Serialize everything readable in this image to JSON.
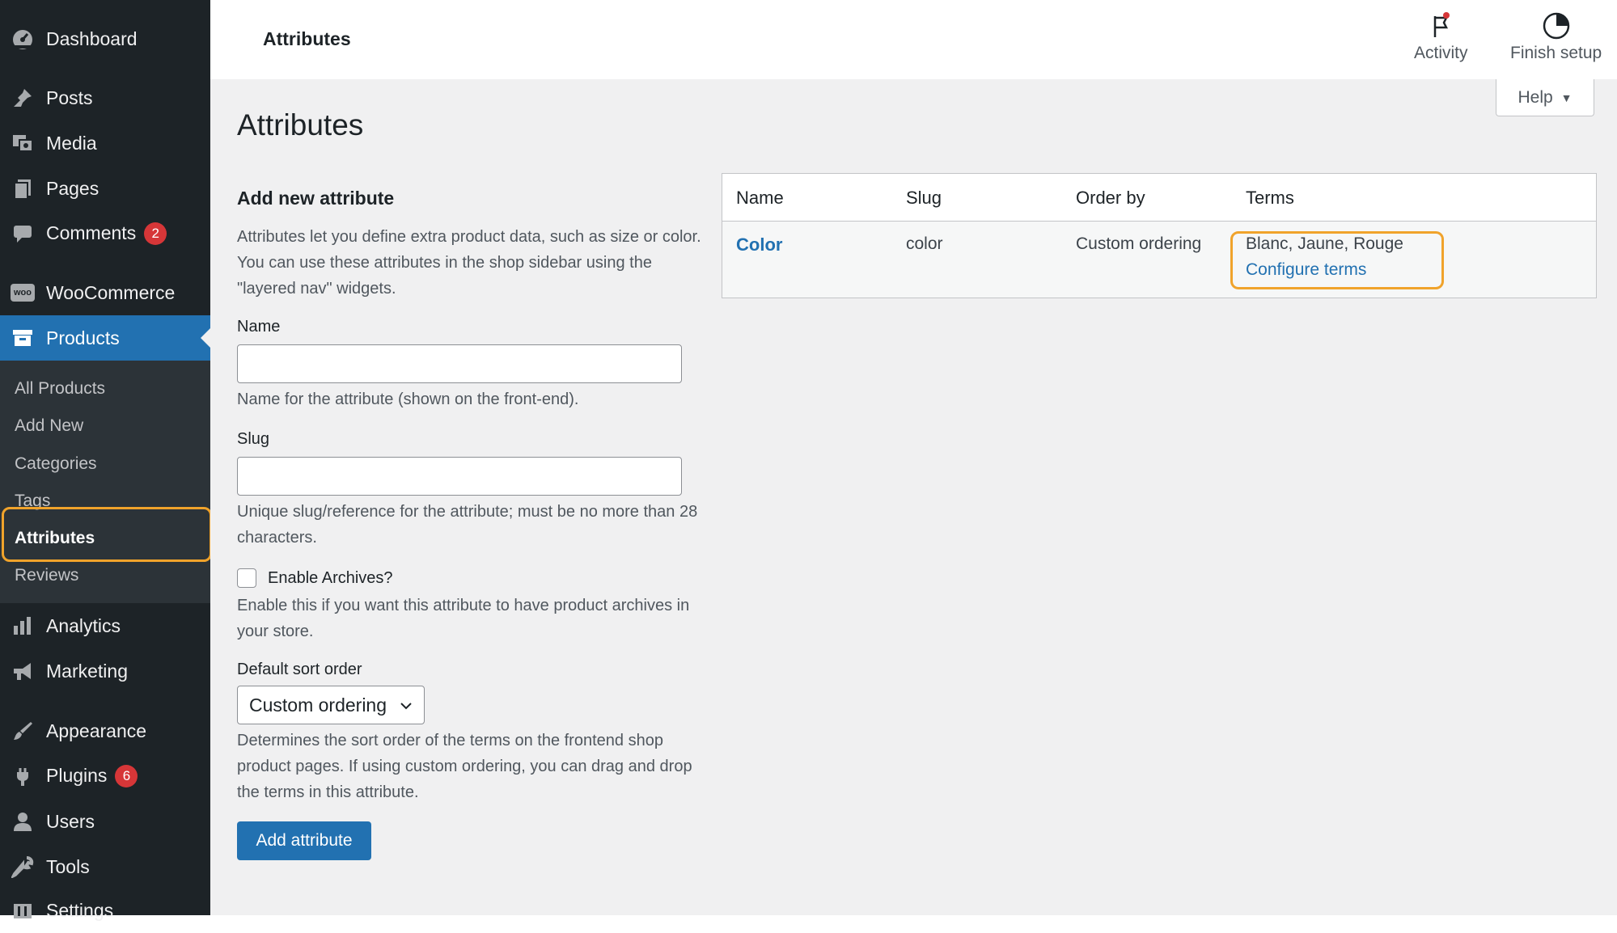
{
  "sidebar": {
    "items": [
      {
        "label": "Dashboard",
        "icon": "dashboard-icon"
      },
      {
        "label": "Posts",
        "icon": "pin-icon"
      },
      {
        "label": "Media",
        "icon": "media-icon"
      },
      {
        "label": "Pages",
        "icon": "pages-icon"
      },
      {
        "label": "Comments",
        "icon": "comment-icon",
        "badge": "2"
      },
      {
        "label": "WooCommerce",
        "icon": "woo-icon"
      },
      {
        "label": "Products",
        "icon": "archive-icon"
      },
      {
        "label": "Analytics",
        "icon": "chart-bar-icon"
      },
      {
        "label": "Marketing",
        "icon": "megaphone-icon"
      },
      {
        "label": "Appearance",
        "icon": "brush-icon"
      },
      {
        "label": "Plugins",
        "icon": "plug-icon",
        "badge": "6"
      },
      {
        "label": "Users",
        "icon": "user-icon"
      },
      {
        "label": "Tools",
        "icon": "wrench-icon"
      },
      {
        "label": "Settings",
        "icon": "settings-icon"
      }
    ],
    "woo_logo_text": "woo",
    "submenu": [
      "All Products",
      "Add New",
      "Categories",
      "Tags",
      "Attributes",
      "Reviews"
    ],
    "active_item": "Products",
    "current_subitem": "Attributes"
  },
  "topbar": {
    "title": "Attributes",
    "activity_label": "Activity",
    "finish_setup_label": "Finish setup"
  },
  "help": {
    "label": "Help"
  },
  "page": {
    "heading": "Attributes"
  },
  "form": {
    "heading": "Add new attribute",
    "intro": "Attributes let you define extra product data, such as size or color. You can use these attributes in the shop sidebar using the \"layered nav\" widgets.",
    "name_label": "Name",
    "name_value": "",
    "name_desc": "Name for the attribute (shown on the front-end).",
    "slug_label": "Slug",
    "slug_value": "",
    "slug_desc": "Unique slug/reference for the attribute; must be no more than 28 characters.",
    "archives_label": "Enable Archives?",
    "archives_checked": false,
    "archives_desc": "Enable this if you want this attribute to have product archives in your store.",
    "sort_label": "Default sort order",
    "sort_value": "Custom ordering",
    "sort_desc": "Determines the sort order of the terms on the frontend shop product pages. If using custom ordering, you can drag and drop the terms in this attribute.",
    "submit_label": "Add attribute"
  },
  "table": {
    "headers": [
      "Name",
      "Slug",
      "Order by",
      "Terms"
    ],
    "rows": [
      {
        "name": "Color",
        "slug": "color",
        "order_by": "Custom ordering",
        "terms": "Blanc, Jaune, Rouge",
        "configure_label": "Configure terms"
      }
    ]
  },
  "colors": {
    "sidebar_bg": "#1d2327",
    "accent": "#2271b1",
    "highlight": "#f0a32b",
    "badge": "#d63638"
  }
}
